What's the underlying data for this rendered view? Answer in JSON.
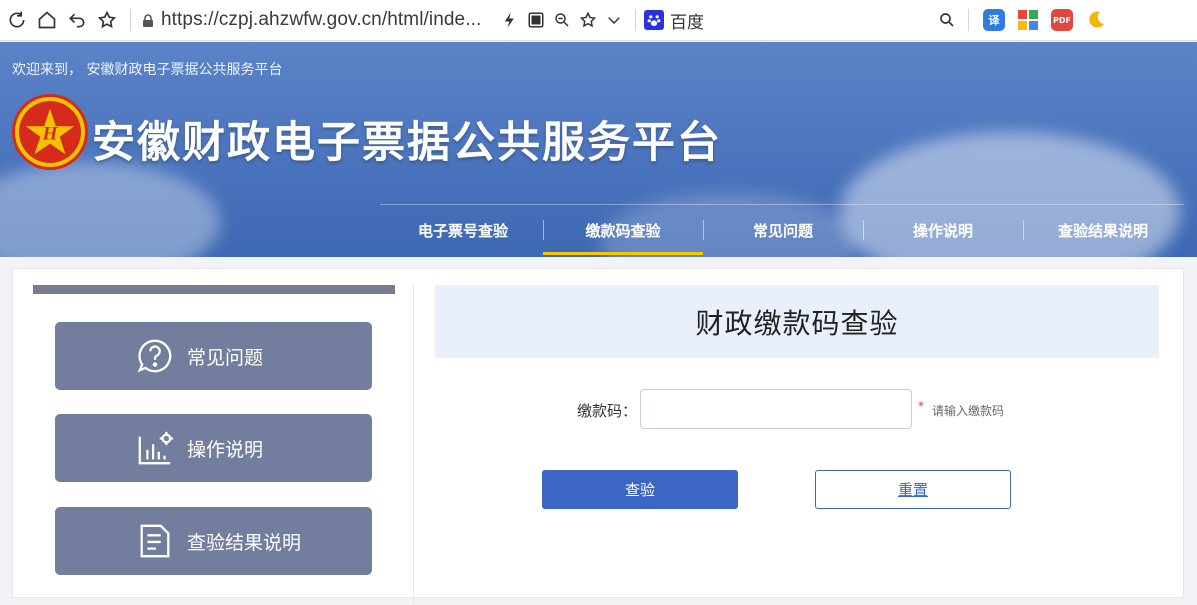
{
  "browser": {
    "url": "https://czpj.ahzwfw.gov.cn/html/inde...",
    "search_engine_label": "百度",
    "icons": [
      "reload-icon",
      "home-icon",
      "back-icon",
      "bookmark-star-icon",
      "lock-icon",
      "lightning-icon",
      "qr-icon",
      "zoom-icon",
      "favorite-icon",
      "chevron-down-icon",
      "baidu-icon",
      "search-icon",
      "translate-icon",
      "apps-icon",
      "pdf-icon",
      "moon-icon"
    ],
    "ext_translate_label": "译",
    "ext_pdf_label": "PDF"
  },
  "banner": {
    "welcome": "欢迎来到， 安徽财政电子票据公共服务平台",
    "title": "安徽财政电子票据公共服务平台",
    "emblem_letter": "H",
    "nav": [
      {
        "label": "电子票号查验",
        "active": false
      },
      {
        "label": "缴款码查验",
        "active": true
      },
      {
        "label": "常见问题",
        "active": false
      },
      {
        "label": "操作说明",
        "active": false
      },
      {
        "label": "查验结果说明",
        "active": false
      }
    ]
  },
  "sidebar": {
    "items": [
      {
        "label": "常见问题",
        "icon": "question-bubble-icon"
      },
      {
        "label": "操作说明",
        "icon": "operation-chart-icon"
      },
      {
        "label": "查验结果说明",
        "icon": "document-icon"
      }
    ]
  },
  "form": {
    "title": "财政缴款码查验",
    "field_label": "缴款码：",
    "field_value": "",
    "required_mark": "*",
    "hint": "请输入缴款码",
    "check_button": "查验",
    "reset_button": "重置"
  },
  "colors": {
    "banner": "#4f78c0",
    "active_underline": "#f5c800",
    "sidebar_button": "#737d9e",
    "primary_button": "#3b66c4",
    "title_panel": "#e9f0fb"
  }
}
